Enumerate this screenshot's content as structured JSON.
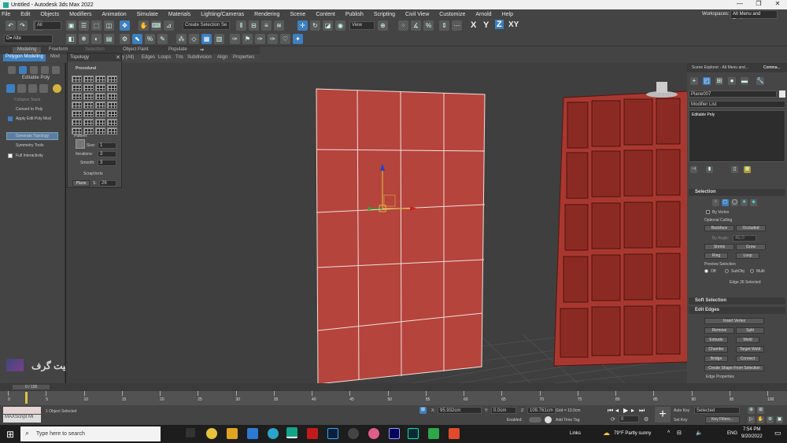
{
  "window": {
    "title": "Untitled - Autodesk 3ds Max 2022",
    "min": "—",
    "max": "❐",
    "close": "✕"
  },
  "menu": [
    "File",
    "Edit",
    "Objects",
    "Modifiers",
    "Animation",
    "Simulate",
    "Materials",
    "Lighting/Cameras",
    "Rendering",
    "Scene",
    "Content",
    "Publish",
    "Scripting",
    "Civil View",
    "Customize",
    "Arnold",
    "Help"
  ],
  "workspace": {
    "label": "Workspaces:",
    "value": "Alt Menu and Toolbar"
  },
  "toolbar": {
    "filter_all": "All",
    "selection_set": "Create Selection Se",
    "view_dropdown": "View",
    "axis": [
      "X",
      "Y",
      "Z",
      "XY"
    ]
  },
  "ribbon": {
    "tabs": [
      "Modeling",
      "Freeform",
      "Selection",
      "Object Paint",
      "Populate"
    ],
    "active_tab": "Polygon Modeling",
    "mod_tab": "Mod",
    "subtabs": [
      "y (All)",
      "Edges",
      "Loops",
      "Tris",
      "Subdivision",
      "Align",
      "Properties"
    ]
  },
  "left_panel": {
    "title": "Editable Poly",
    "collapse_stack": "Collapse Stack",
    "convert": "Convert to Poly",
    "apply_mod": "Apply Edit Poly Mod",
    "generate": "Generate Topology",
    "symmetry": "Symmetry Tools",
    "full_interactivity": "Full Interactivity"
  },
  "topology": {
    "title": "Topology",
    "section": "Procedural",
    "pattern_label": "Pattern:",
    "size_label": "Size:",
    "size": "1",
    "iterations_label": "Iterations:",
    "iterations": "3",
    "smooth_label": "Smooth:",
    "smooth": "3",
    "scrap_verts": "ScrapVerts",
    "plane": "Plane",
    "s_label": "S:",
    "s_value": "26"
  },
  "watermark": "آکادمی بیت گرف",
  "right_panel": {
    "scene_explorer": "Scene Explorer - Alt Menu and...",
    "command_tab": "Comma...",
    "object_name": "Plane007",
    "modifier_list": "Modifier List",
    "stack_item": "Editable Poly",
    "selection_title": "Selection",
    "by_vertex": "By Vertex",
    "optional_culling": "Optional Culling",
    "backface": "Backface",
    "occluded": "Occluded",
    "by_angle": "By Angle:",
    "by_angle_value": "45.0",
    "shrink": "Shrink",
    "grow": "Grow",
    "ring": "Ring",
    "loop": "Loop",
    "preview_selection": "Preview Selection",
    "preview_options": [
      "Off",
      "SubObj",
      "Multi"
    ],
    "edge_count": "Edge 26 Selected",
    "soft_selection": "Soft Selection",
    "edit_edges": "Edit Edges",
    "insert_vertex": "Insert Vertex",
    "remove": "Remove",
    "split": "Split",
    "extrude": "Extrude",
    "weld": "Weld",
    "chamfer": "Chamfer",
    "target_weld": "Target Weld",
    "bridge": "Bridge",
    "connect": "Connect",
    "create_shape": "Create Shape From Selection",
    "edge_properties": "Edge Properties"
  },
  "timeline": {
    "frame": "0 / 100",
    "ticks": [
      "0",
      "5",
      "10",
      "15",
      "20",
      "25",
      "30",
      "35",
      "40",
      "45",
      "50",
      "55",
      "60",
      "65",
      "70",
      "75",
      "80",
      "85",
      "90",
      "95",
      "100"
    ]
  },
  "status": {
    "maxscript": "MAXScript Mi",
    "selected": "1 Object Selected",
    "x_label": "X:",
    "x_value": "95.932cm",
    "y_label": "Y:",
    "y_value": "0.0cm",
    "z_label": "Z:",
    "z_value": "109.761cm",
    "grid": "Grid = 10.0cm",
    "enabled": "Enabled:",
    "add_time_tag": "Add Time Tag",
    "auto_key": "Auto Key",
    "set_key": "Set Key",
    "selected_dd": "Selected",
    "key_filters": "Key Filters...",
    "frame_field": "0"
  },
  "taskbar": {
    "search": "Type here to search",
    "links": "Links",
    "weather": "79°F  Partly sunny",
    "lang": "ENG",
    "time": "7:54 PM",
    "date": "9/20/2022"
  },
  "colors": {
    "accent": "#3d7fbf",
    "mesh": "#b5443c",
    "shelf": "#a8382f",
    "bg": "#3f3f3f"
  }
}
